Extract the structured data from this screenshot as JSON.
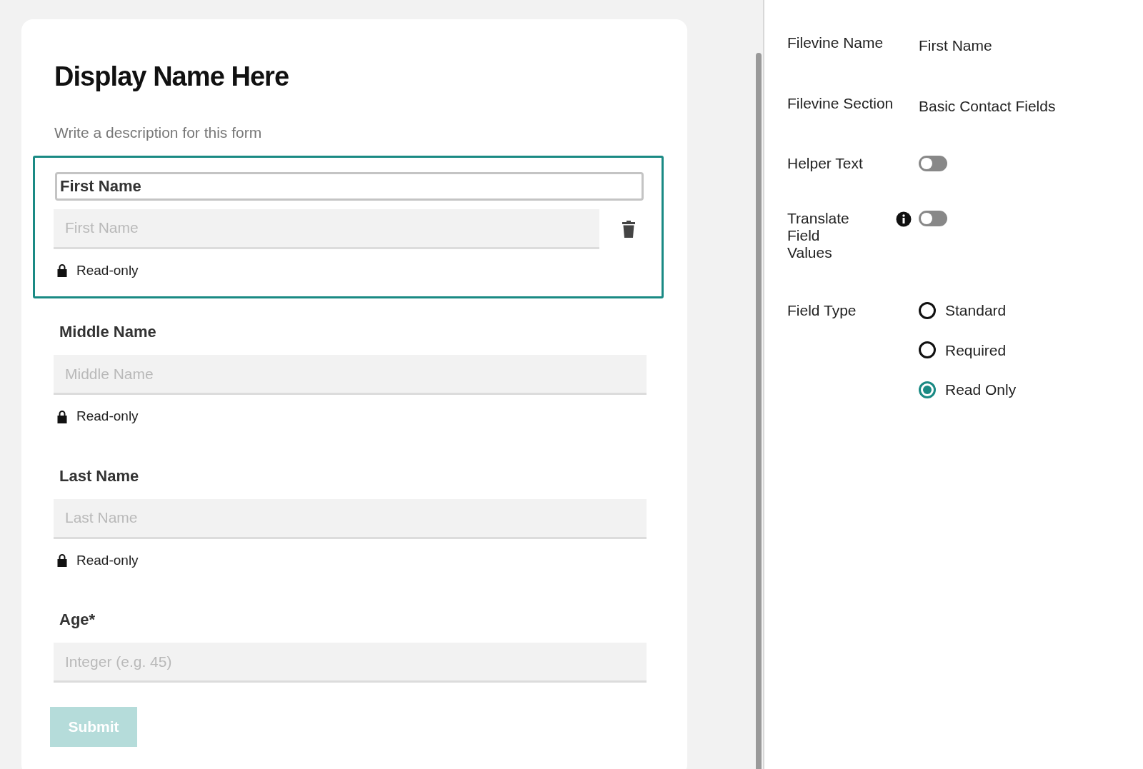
{
  "form": {
    "title": "Display Name Here",
    "description": "Write a description for this form",
    "fields": [
      {
        "label": "First Name",
        "placeholder": "First Name",
        "note": "Read-only",
        "selected": true
      },
      {
        "label": "Middle Name",
        "placeholder": "Middle Name",
        "note": "Read-only",
        "selected": false
      },
      {
        "label": "Last Name",
        "placeholder": "Last Name",
        "note": "Read-only",
        "selected": false
      },
      {
        "label": "Age*",
        "placeholder": "Integer (e.g. 45)",
        "selected": false
      }
    ],
    "submit": {
      "label": "Submit",
      "disabled": true
    }
  },
  "properties": {
    "rows": [
      {
        "kind": "text",
        "label": "Filevine Name",
        "value": "First Name"
      },
      {
        "kind": "text",
        "label": "Filevine Section",
        "value": "Basic Contact Fields"
      },
      {
        "kind": "toggle",
        "label": "Helper Text",
        "on": false
      },
      {
        "kind": "toggle",
        "label": "Translate Field Values",
        "on": false,
        "info": true
      }
    ],
    "field_type": {
      "label": "Field Type",
      "options": [
        {
          "label": "Standard",
          "selected": false
        },
        {
          "label": "Required",
          "selected": false
        },
        {
          "label": "Read Only",
          "selected": true
        }
      ]
    }
  }
}
